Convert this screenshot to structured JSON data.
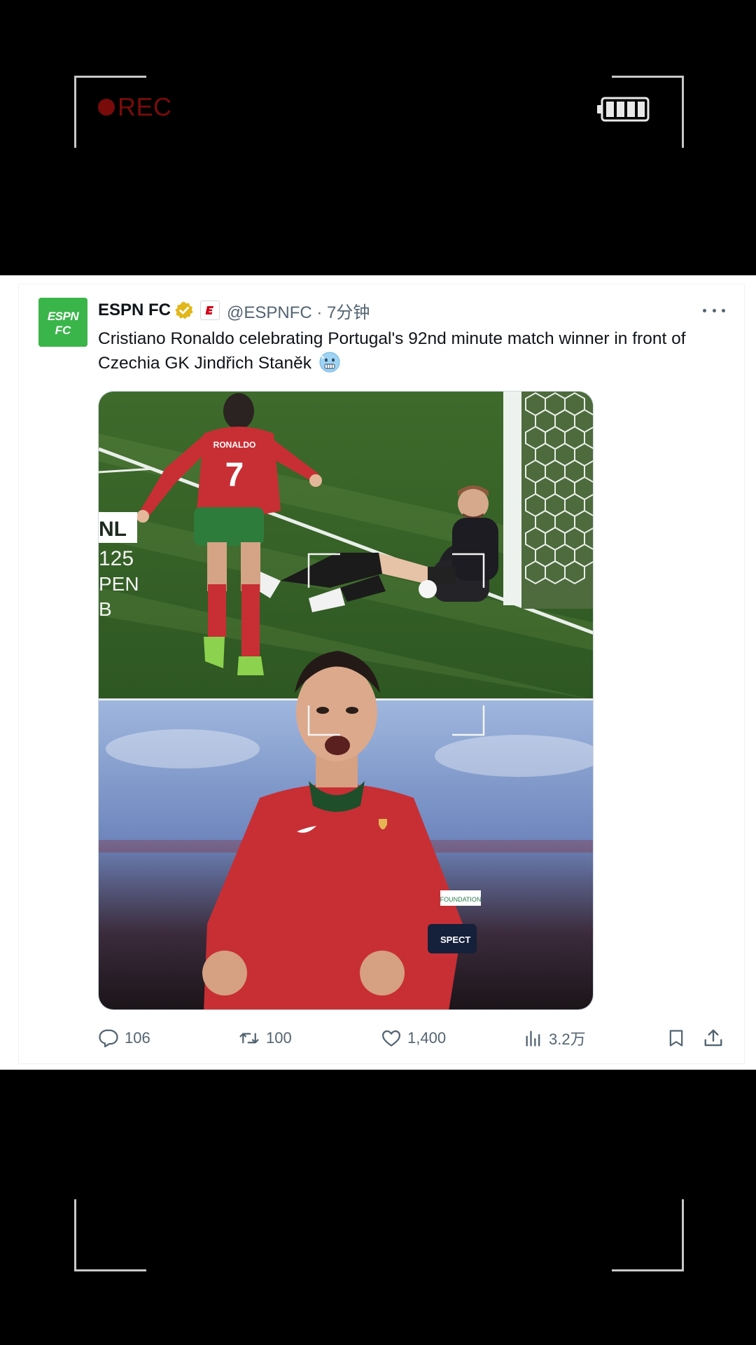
{
  "overlay": {
    "rec_label": "REC"
  },
  "tweet": {
    "author_name": "ESPN FC",
    "handle_time": "@ESPNFC · 7分钟",
    "avatar_text": "ESPN FC",
    "text": "Cristiano Ronaldo celebrating Portugal's 92nd minute match winner in front of Czechia GK Jindřich Staněk",
    "media": {
      "overlay_lines": [
        "NL",
        "125",
        "PEN",
        "B"
      ],
      "jersey_name": "RONALDO",
      "jersey_number": "7",
      "sleeve_patch": "FOUNDATION",
      "armband": "SPECT"
    },
    "stats": {
      "replies": "106",
      "retweets": "100",
      "likes": "1,400",
      "views": "3.2万"
    }
  },
  "colors": {
    "espn_green": "#3ab54a",
    "verified_gold": "#e2b719",
    "text_primary": "#0f1419",
    "text_secondary": "#536471",
    "rec_red": "#7a0b0b"
  }
}
